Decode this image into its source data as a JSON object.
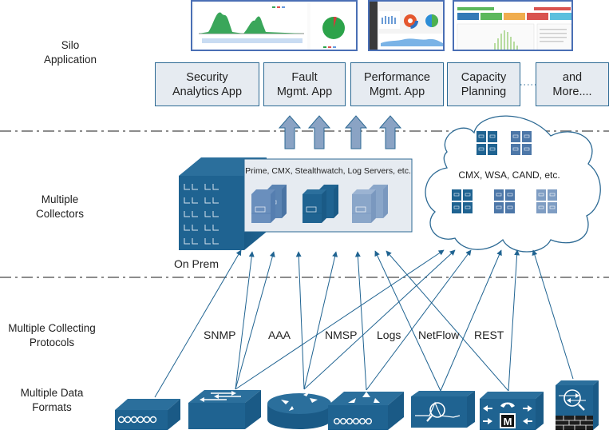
{
  "layers": [
    {
      "label": "Silo\nApplication"
    },
    {
      "label": "Multiple\nCollectors"
    },
    {
      "label": "Multiple Collecting\nProtocols"
    },
    {
      "label": "Multiple Data\nFormats"
    }
  ],
  "applications": [
    {
      "label": "Security\nAnalytics App"
    },
    {
      "label": "Fault\nMgmt. App"
    },
    {
      "label": "Performance\nMgmt. App"
    },
    {
      "label": "Capacity\nPlanning"
    },
    {
      "label": "and\nMore...."
    }
  ],
  "collectors": {
    "on_prem_label": "On Prem",
    "on_prem_servers_caption": "Prime, CMX, Stealthwatch, Log Servers, etc.",
    "cloud_caption": "CMX, WSA, CAND, etc."
  },
  "protocols": [
    "SNMP",
    "AAA",
    "NMSP",
    "Logs",
    "NetFlow",
    "REST"
  ],
  "devices": [
    {
      "icon": "modem-icon"
    },
    {
      "icon": "switch-icon"
    },
    {
      "icon": "router-icon"
    },
    {
      "icon": "wireless-controller-icon"
    },
    {
      "icon": "network-analyzer-icon"
    },
    {
      "icon": "voice-gateway-icon"
    },
    {
      "icon": "security-appliance-icon"
    }
  ],
  "colors": {
    "device_blue": "#1f6391",
    "box_fill": "#e6ebf1",
    "box_border": "#2d6a94",
    "up_arrow": "#8aa3c4",
    "line": "#1f6391",
    "separator": "#8c8c8c"
  }
}
